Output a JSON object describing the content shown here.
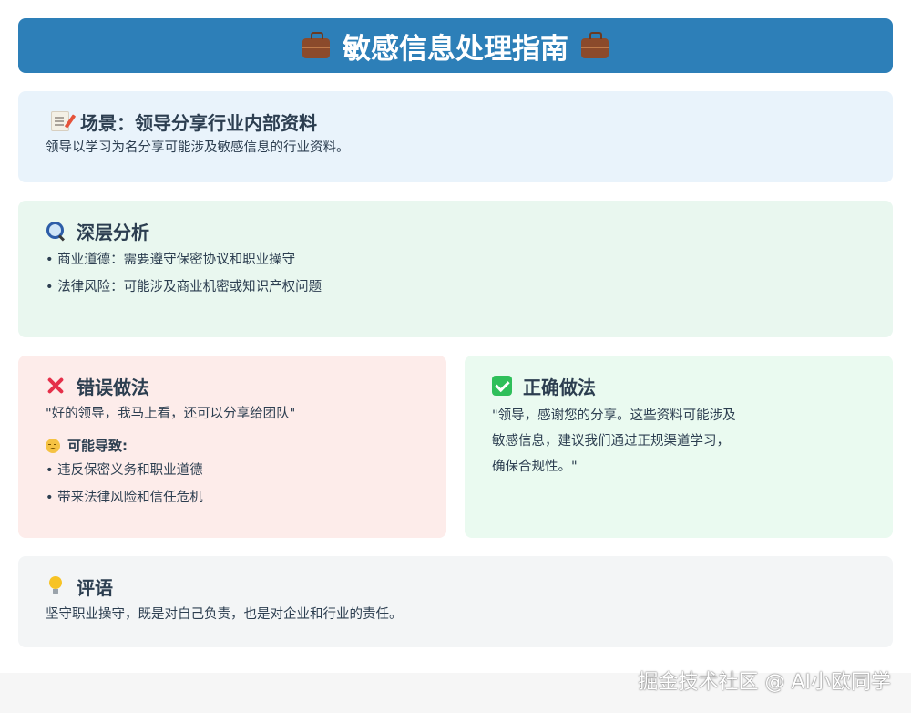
{
  "header": {
    "title": "敏感信息处理指南",
    "icon": "briefcase-icon",
    "color": "#2d7fb8"
  },
  "scenario": {
    "icon": "memo-icon",
    "title": "场景：领导分享行业内部资料",
    "text": "领导以学习为名分享可能涉及敏感信息的行业资料。"
  },
  "analysis": {
    "icon": "magnifier-icon",
    "title": "深层分析",
    "items": [
      "• 商业道德：需要遵守保密协议和职业操守",
      "• 法律风险：可能涉及商业机密或知识产权问题"
    ]
  },
  "wrong": {
    "icon": "cross-icon",
    "title": "错误做法",
    "quote": "\"好的领导，我马上看，还可以分享给团队\"",
    "consequence_icon": "pensive-face-icon",
    "consequence_title": "可能导致:",
    "items": [
      "• 违反保密义务和职业道德",
      "• 带来法律风险和信任危机"
    ]
  },
  "right": {
    "icon": "check-icon",
    "title": "正确做法",
    "quote_lines": [
      "\"领导，感谢您的分享。这些资料可能涉及",
      "敏感信息，建议我们通过正规渠道学习，",
      "确保合规性。\""
    ]
  },
  "comment": {
    "icon": "lightbulb-icon",
    "title": "评语",
    "text": "坚守职业操守，既是对自己负责，也是对企业和行业的责任。"
  },
  "watermark": "掘金技术社区 @ AI小欧同学"
}
